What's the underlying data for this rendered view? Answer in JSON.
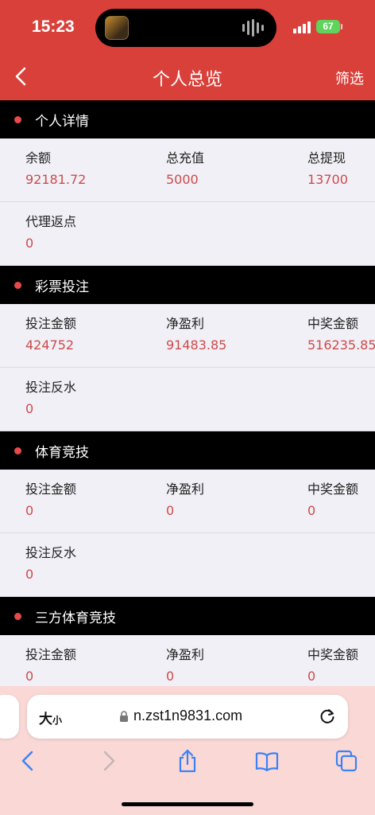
{
  "status": {
    "time": "15:23",
    "battery": "67"
  },
  "header": {
    "title": "个人总览",
    "filter_label": "筛选"
  },
  "sections": {
    "personal": {
      "title": "个人详情",
      "r1": [
        {
          "label": "余额",
          "value": "92181.72"
        },
        {
          "label": "总充值",
          "value": "5000"
        },
        {
          "label": "总提现",
          "value": "13700"
        }
      ],
      "r2": [
        {
          "label": "代理返点",
          "value": "0"
        }
      ]
    },
    "lottery": {
      "title": "彩票投注",
      "r1": [
        {
          "label": "投注金额",
          "value": "424752"
        },
        {
          "label": "净盈利",
          "value": "91483.85"
        },
        {
          "label": "中奖金额",
          "value": "516235.85"
        }
      ],
      "r2": [
        {
          "label": "投注反水",
          "value": "0"
        }
      ]
    },
    "sports": {
      "title": "体育竞技",
      "r1": [
        {
          "label": "投注金额",
          "value": "0"
        },
        {
          "label": "净盈利",
          "value": "0"
        },
        {
          "label": "中奖金额",
          "value": "0"
        }
      ],
      "r2": [
        {
          "label": "投注反水",
          "value": "0"
        }
      ]
    },
    "third_sports": {
      "title": "三方体育竞技",
      "r1": [
        {
          "label": "投注金额",
          "value": "0"
        },
        {
          "label": "净盈利",
          "value": "0"
        },
        {
          "label": "中奖金额",
          "value": "0"
        }
      ]
    }
  },
  "browser": {
    "text_size_label": "大",
    "text_size_small": "小",
    "url": "n.zst1n9831.com"
  },
  "icons": {
    "back": "chevron-left-icon",
    "lock": "lock-icon",
    "reload": "reload-icon",
    "nav_back": "back-arrow-icon",
    "nav_forward": "forward-arrow-icon",
    "share": "share-icon",
    "bookmarks": "book-icon",
    "tabs": "tabs-icon"
  },
  "colors": {
    "header_bg": "#d9403a",
    "accent_value": "#cf4a4a",
    "section_bg": "#000000",
    "section_dot": "#e84a4a"
  }
}
